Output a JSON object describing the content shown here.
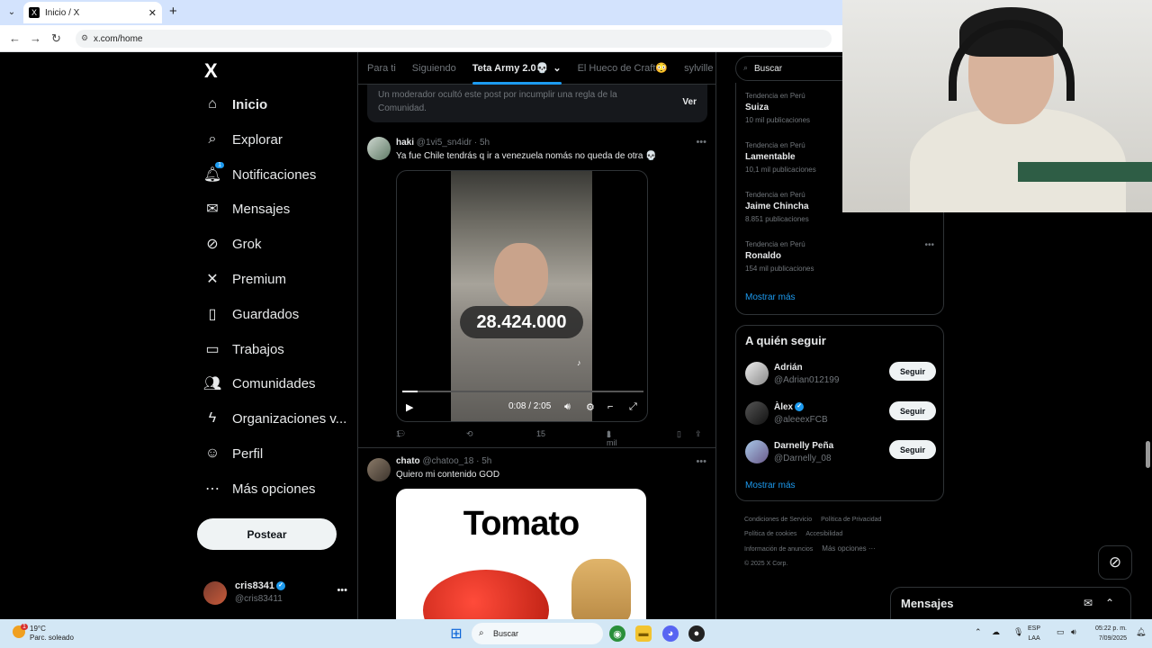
{
  "browser": {
    "tab_title": "Inicio / X",
    "tab_favicon": "X",
    "url": "x.com/home"
  },
  "nav": {
    "logo": "X",
    "items": [
      {
        "label": "Inicio",
        "icon": "home-icon"
      },
      {
        "label": "Explorar",
        "icon": "search-icon"
      },
      {
        "label": "Notificaciones",
        "icon": "bell-icon",
        "badge": "1"
      },
      {
        "label": "Mensajes",
        "icon": "mail-icon"
      },
      {
        "label": "Grok",
        "icon": "grok-icon"
      },
      {
        "label": "Premium",
        "icon": "x-icon"
      },
      {
        "label": "Guardados",
        "icon": "bookmark-icon"
      },
      {
        "label": "Trabajos",
        "icon": "briefcase-icon"
      },
      {
        "label": "Comunidades",
        "icon": "people-icon"
      },
      {
        "label": "Organizaciones v...",
        "icon": "lightning-icon"
      },
      {
        "label": "Perfil",
        "icon": "person-icon"
      },
      {
        "label": "Más opciones",
        "icon": "more-circle-icon"
      }
    ],
    "post_button": "Postear",
    "account": {
      "name": "cris8341",
      "handle": "@cris83411"
    }
  },
  "feed": {
    "tabs": [
      "Para ti",
      "Siguiendo",
      "Teta Army 2.0💀",
      "El Hueco de Craft😳",
      "sylville"
    ],
    "moderated": {
      "text": "Un moderador ocultó este post por incumplir una regla de la Comunidad.",
      "action": "Ver"
    },
    "post1": {
      "name": "haki",
      "handle": "@1vi5_sn4idr",
      "time": "· 5h",
      "text": "Ya fue Chile tendrás q ir a venezuela nomás no queda de otra 💀",
      "video_number": "28.424.000",
      "video_time": "0:08 / 2:05",
      "video_progress": 0.064,
      "replies": "1",
      "likes": "15",
      "views": "1 mil"
    },
    "post2": {
      "name": "chato",
      "handle": "@chatoo_18",
      "time": "· 5h",
      "text": "Quiero mi contenido GOD",
      "image_text": "Tomato"
    }
  },
  "right": {
    "search_placeholder": "Buscar",
    "trends": [
      {
        "context": "Tendencia en Perú",
        "name": "Suiza",
        "count": "10 mil publicaciones"
      },
      {
        "context": "Tendencia en Perú",
        "name": "Lamentable",
        "count": "10,1 mil publicaciones"
      },
      {
        "context": "Tendencia en Perú",
        "name": "Jaime Chincha",
        "count": "8.851 publicaciones"
      },
      {
        "context": "Tendencia en Perú",
        "name": "Ronaldo",
        "count": "154 mil publicaciones"
      }
    ],
    "show_more": "Mostrar más",
    "who_to_follow": {
      "title": "A quién seguir",
      "users": [
        {
          "name": "Adrián",
          "handle": "@Adrian012199",
          "button": "Seguir"
        },
        {
          "name": "Àlex",
          "handle": "@aleeexFCB",
          "button": "Seguir"
        },
        {
          "name": "Darnelly Peña",
          "handle": "@Darnelly_08",
          "button": "Seguir"
        }
      ],
      "show_more": "Mostrar más"
    },
    "footer": [
      "Condiciones de Servicio",
      "Política de Privacidad",
      "Política de cookies",
      "Accesibilidad",
      "Información de anuncios",
      "Más opciones ···",
      "© 2025 X Corp."
    ],
    "messages_dock": "Mensajes"
  },
  "taskbar": {
    "temp": "19°C",
    "weather": "Parc. soleado",
    "weather_badge": "1",
    "search": "Buscar",
    "lang1": "ESP",
    "lang2": "LAA",
    "time": "05:22 p. m.",
    "date": "7/09/2025"
  },
  "colors": {
    "accent": "#1d9bf0",
    "background": "#000000",
    "taskbar": "#d3e7f5"
  }
}
